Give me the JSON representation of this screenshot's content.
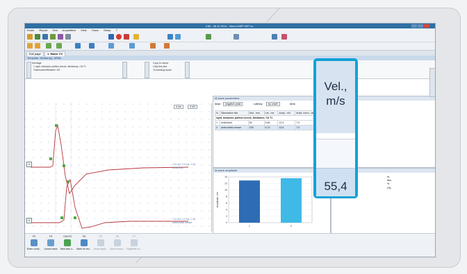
{
  "window": {
    "title": "KIM , 08.10.2014 - Neuro-MEP-NET.ru"
  },
  "menu": [
    "Exam",
    "Report",
    "Test",
    "Acquisition",
    "View",
    "Trace",
    "Setup",
    "?"
  ],
  "tabs": [
    "Exit page",
    "1. Motor CV"
  ],
  "template_bar": "Template: Median(s), ARMs",
  "settings": {
    "montage_label": "Montage",
    "montage_item": "1 right, Abductor pollicis brevis, Medianus, C8 T1",
    "total_label": "Total traces/Relative: 2/0",
    "copy_to_report": "Copy to report",
    "only_this_test": "Only this test",
    "to_existing_report": "To existing report",
    "side_tab_1": "Channels",
    "side_tab_2": "Stimulus",
    "side_tab_3": "Report",
    "side_tab_4": "Amplifier"
  },
  "traces": {
    "trace1_marker": "1",
    "trace2_marker": "2",
    "trace1_note1": "+13 mV, 0.2 ms, 1 Hz",
    "trace1_note2": "wrist/wrist",
    "trace2_note1": "+13 mV, 0.2 ms, 1 Hz",
    "trace2_note2": "antecubital crease",
    "scale1": "4 ms",
    "scale2": "4 mV"
  },
  "mwave_params": {
    "title": "M-wave parameters",
    "ampl_label": "Ampl.",
    "ampl_value": "negative peak",
    "latency_label": "Latency",
    "latency_value": "by onset",
    "area_label": "Area",
    "headers": [
      "N",
      "Stimulation site",
      "Dist., mm",
      "Lat., ms",
      "Ampl., mV",
      "Ampl. norm., dev., %",
      "Area"
    ],
    "group_row": "right, Abductor pollicis brevis, Medianus, C8 T1",
    "rows": [
      [
        "1",
        "wrist/wrist",
        "60",
        "3,65",
        "12,9",
        "7,0",
        "(%)"
      ],
      [
        "2",
        "antecubital crease",
        "205",
        "6,73",
        "13,6",
        "7,0",
        "(%)"
      ]
    ]
  },
  "amplitude_chart": {
    "title": "M-wave amplitude",
    "ylabel": "Amplitude, mV",
    "yticks": [
      "14",
      "12",
      "10",
      "8",
      "6",
      "4",
      "2",
      "0"
    ]
  },
  "chart_data": {
    "type": "bar",
    "categories": [
      "1",
      "2"
    ],
    "values": [
      12.9,
      13.6
    ],
    "ylabel": "Amplitude, mV",
    "ylim": [
      0,
      14
    ]
  },
  "right_panel": {
    "title": "... cy and PDF",
    "lines": [
      "m,",
      "dev.,",
      "%",
      "(%)"
    ]
  },
  "callout": {
    "header_line1": "Vel.,",
    "header_line2": "m/s",
    "value": "55,4"
  },
  "side_tab_right": "Waveform display",
  "function_keys": [
    {
      "key": "F2",
      "label": "Enter condi..."
    },
    {
      "key": "F3",
      "label": "Linked trace"
    },
    {
      "key": "Ctrl+F4",
      "label": "New test, s..."
    },
    {
      "key": "F6",
      "label": "Mark for rec..."
    },
    {
      "key": "F5",
      "label": "Move back..."
    },
    {
      "key": "F6",
      "label": "Move forwa..."
    },
    {
      "key": "F7",
      "label": "Right/left co..."
    }
  ],
  "colors": {
    "accent": "#13a2d6",
    "titlebar": "#2f6fa3",
    "trace": "#b5353c",
    "bar_dark": "#2e6db6",
    "bar_light": "#3fb9e6"
  }
}
